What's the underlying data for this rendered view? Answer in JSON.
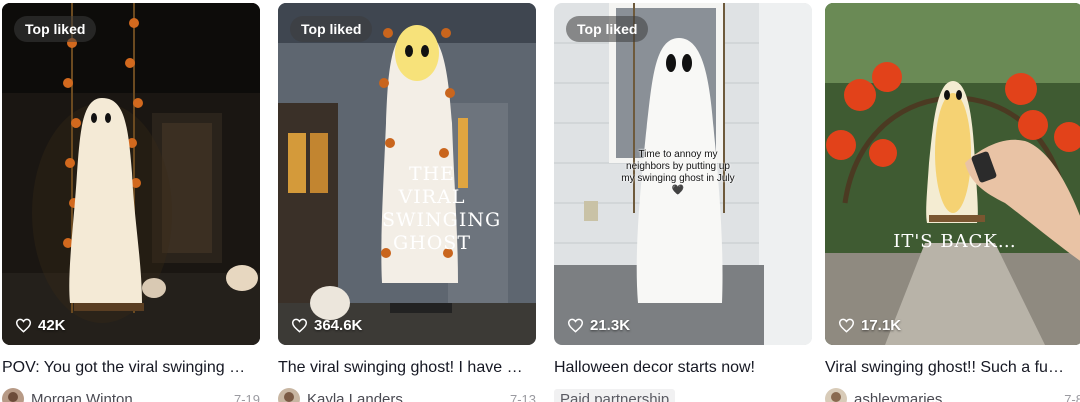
{
  "cards": [
    {
      "badge": "Top liked",
      "likes": "42K",
      "caption": "POV: You got the viral swinging ghost…",
      "author": "Morgan Winton",
      "date": "7-19",
      "overlay": ""
    },
    {
      "badge": "Top liked",
      "likes": "364.6K",
      "caption": "The viral swinging ghost! I have …",
      "author": "Kayla Landers",
      "date": "7-13",
      "overlay": "THE VIRAL SWINGING GHOST"
    },
    {
      "badge": "Top liked",
      "likes": "21.3K",
      "caption": "Halloween decor starts now!",
      "author": "",
      "date": "",
      "paid_label": "Paid partnership",
      "overlay": "Time to annoy my neighbors by putting up my swinging ghost in July 🖤"
    },
    {
      "badge": "",
      "likes": "17.1K",
      "caption": "Viral swinging ghost!! Such a fu…",
      "author": "ashleymaries…",
      "date": "7-8",
      "overlay": "IT'S BACK…"
    }
  ],
  "icons": {
    "like": "heart-outline-icon"
  }
}
